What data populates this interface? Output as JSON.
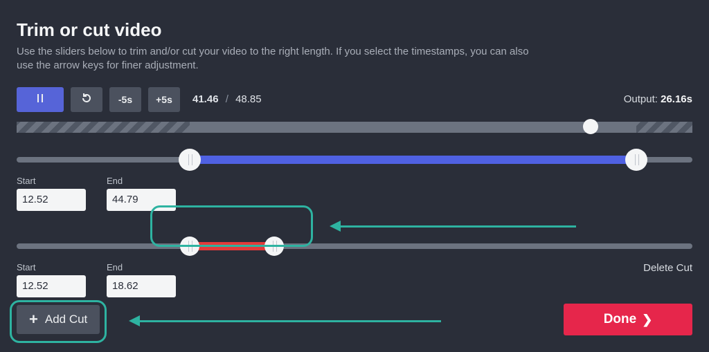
{
  "header": {
    "title": "Trim or cut video",
    "subtitle": "Use the sliders below to trim and/or cut your video to the right length. If you select the timestamps, you can also use the arrow keys for finer adjustment."
  },
  "transport": {
    "back5_label": "-5s",
    "fwd5_label": "+5s",
    "current": "41.46",
    "separator": "/",
    "total": "48.85"
  },
  "output": {
    "label": "Output:",
    "value": "26.16s"
  },
  "trim": {
    "start_label": "Start",
    "end_label": "End",
    "start_value": "12.52",
    "end_value": "44.79",
    "start_pct": 25.6,
    "end_pct": 91.7
  },
  "cuts": [
    {
      "start_label": "Start",
      "end_label": "End",
      "start_value": "12.52",
      "end_value": "18.62",
      "start_pct": 25.6,
      "end_pct": 38.1,
      "delete_label": "Delete Cut"
    }
  ],
  "playhead_pct": 84.9,
  "footer": {
    "add_cut_label": "Add Cut",
    "done_label": "Done"
  }
}
